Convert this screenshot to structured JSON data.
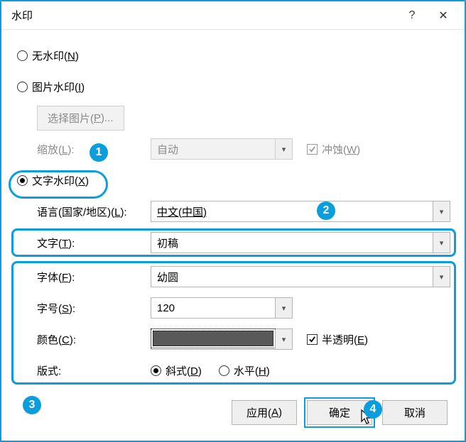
{
  "title": "水印",
  "titlebar": {
    "help": "?",
    "close": "✕"
  },
  "options": {
    "no_watermark": {
      "label": "无水印(",
      "mn": "N",
      "tail": ")"
    },
    "picture_watermark": {
      "label": "图片水印(",
      "mn": "I",
      "tail": ")"
    },
    "select_picture": {
      "label": "选择图片(",
      "mn": "P",
      "tail": ")..."
    },
    "scale": {
      "label": "缩放(",
      "mn": "L",
      "tail": "):",
      "value": "自动"
    },
    "washout": {
      "label": "冲蚀(",
      "mn": "W",
      "tail": ")"
    },
    "text_watermark": {
      "label": "文字水印(",
      "mn": "X",
      "tail": ")"
    }
  },
  "text_wm": {
    "language": {
      "label": "语言(国家/地区)(",
      "mn": "L",
      "tail": "):",
      "value": "中文(中国)"
    },
    "text": {
      "label": "文字(",
      "mn": "T",
      "tail": "):",
      "value": "初稿"
    },
    "font": {
      "label": "字体(",
      "mn": "F",
      "tail": "):",
      "value": "幼圆"
    },
    "size": {
      "label": "字号(",
      "mn": "S",
      "tail": "):",
      "value": "120"
    },
    "color": {
      "label": "颜色(",
      "mn": "C",
      "tail": "):",
      "value": "#595959"
    },
    "semi": {
      "label": "半透明(",
      "mn": "E",
      "tail": ")"
    },
    "layout": {
      "label": "版式:",
      "diagonal": {
        "label": "斜式(",
        "mn": "D",
        "tail": ")"
      },
      "horizontal": {
        "label": "水平(",
        "mn": "H",
        "tail": ")"
      }
    }
  },
  "footer": {
    "apply": {
      "label": "应用(",
      "mn": "A",
      "tail": ")"
    },
    "ok": "确定",
    "cancel": "取消"
  },
  "annot": {
    "n1": "1",
    "n2": "2",
    "n3": "3",
    "n4": "4"
  }
}
